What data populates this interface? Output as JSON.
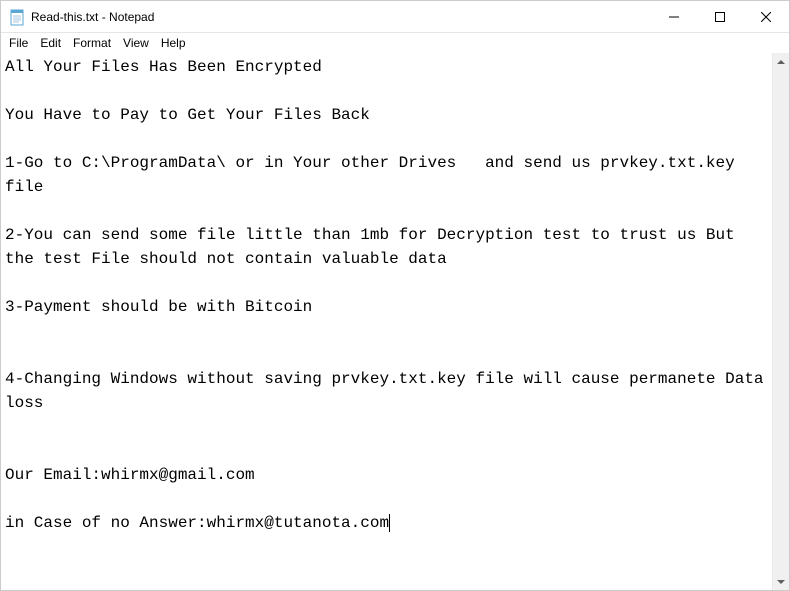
{
  "titlebar": {
    "text": "Read-this.txt - Notepad"
  },
  "menubar": {
    "items": [
      "File",
      "Edit",
      "Format",
      "View",
      "Help"
    ]
  },
  "document": {
    "text": "All Your Files Has Been Encrypted\n\nYou Have to Pay to Get Your Files Back\n\n1-Go to C:\\ProgramData\\ or in Your other Drives   and send us prvkey.txt.key  file\n\n2-You can send some file little than 1mb for Decryption test to trust us But the test File should not contain valuable data\n\n3-Payment should be with Bitcoin\n\n\n4-Changing Windows without saving prvkey.txt.key file will cause permanete Data loss\n\n\nOur Email:whirmx@gmail.com\n\nin Case of no Answer:whirmx@tutanota.com"
  }
}
